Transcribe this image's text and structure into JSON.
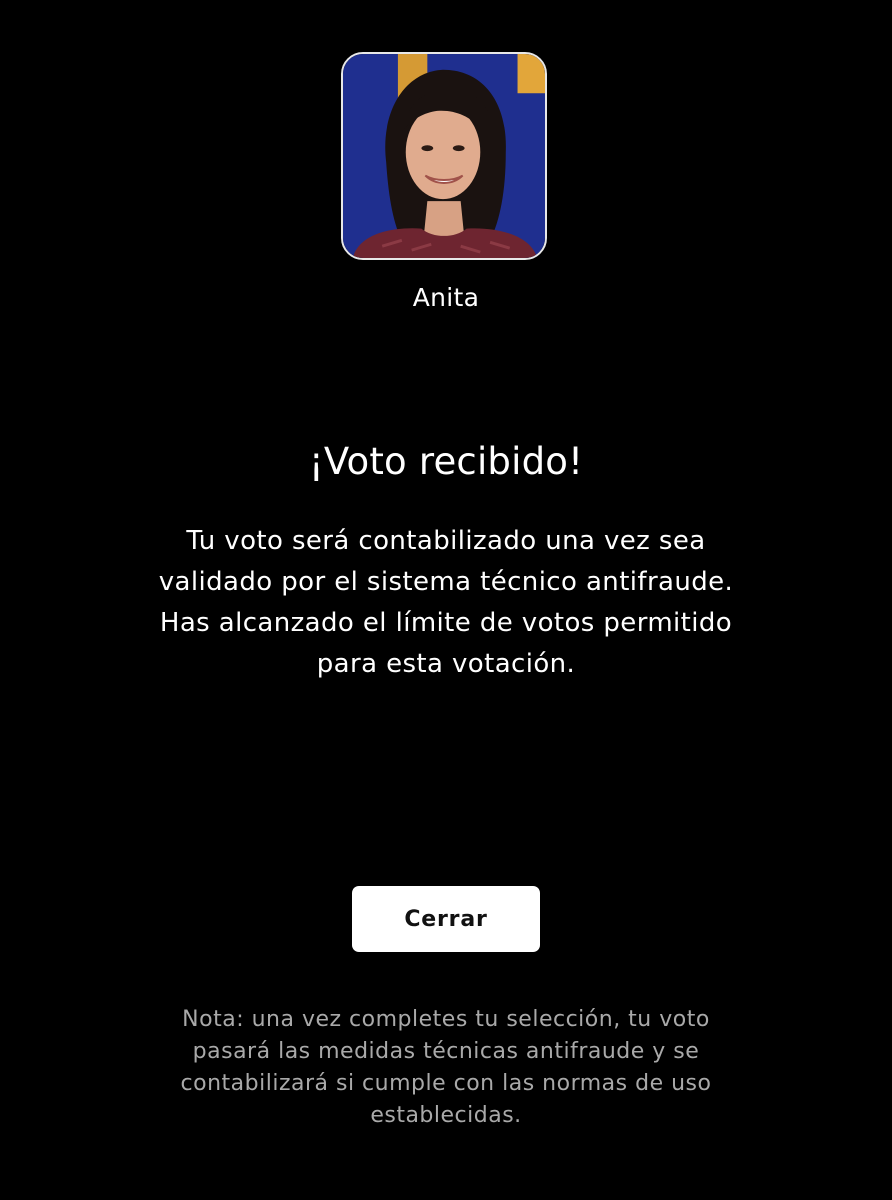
{
  "contestant": {
    "name": "Anita",
    "photo": "contestant-portrait"
  },
  "confirmation": {
    "title": "¡Voto recibido!",
    "message_lines": [
      "Tu voto será contabilizado una vez sea",
      "validado por el sistema técnico antifraude.",
      "Has alcanzado el límite de votos permitido",
      "para esta votación."
    ]
  },
  "actions": {
    "close_label": "Cerrar"
  },
  "note": {
    "lines": [
      "Nota: una vez completes tu selección, tu voto",
      "pasará las medidas técnicas antifraude y se",
      "contabilizará si cumple con las normas de uso",
      "establecidas."
    ]
  },
  "colors": {
    "background": "#000000",
    "text": "#ffffff",
    "note_text": "#a9a9a9",
    "button_bg": "#ffffff",
    "button_text": "#111111",
    "photo_bg_blue": "#1f2f8f",
    "photo_bg_gold": "#e2a63a"
  }
}
